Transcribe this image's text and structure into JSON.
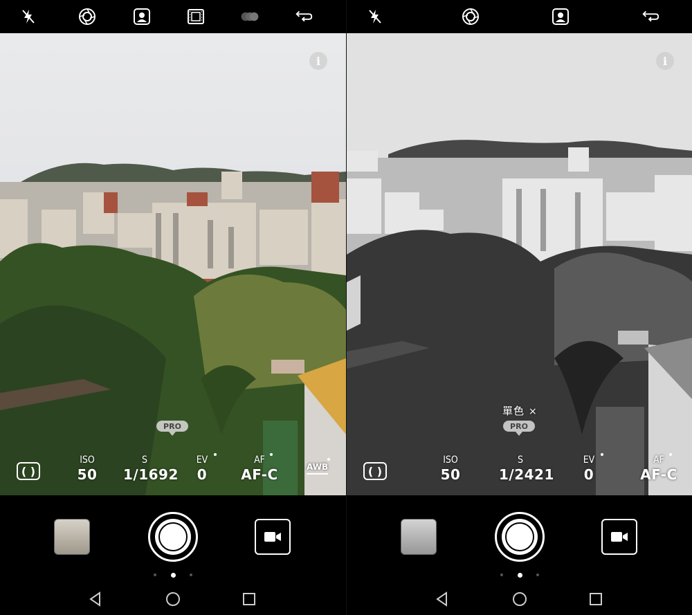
{
  "left": {
    "top_icons": [
      "flash-off-icon",
      "aperture-icon",
      "portrait-icon",
      "film-icon",
      "filter-circles-icon",
      "switch-camera-icon"
    ],
    "info_label": "i",
    "pro_badge": "PRO",
    "metering_label": "( )",
    "params": {
      "iso": {
        "label": "ISO",
        "value": "50"
      },
      "s": {
        "label": "S",
        "value": "1/1692"
      },
      "ev": {
        "label": "EV",
        "value": "0"
      },
      "af": {
        "label": "AF",
        "value": "AF-C"
      },
      "awb": {
        "label": "AWB"
      }
    },
    "pager": {
      "count": 3,
      "active": 1
    }
  },
  "right": {
    "top_icons": [
      "flash-off-icon",
      "aperture-icon",
      "portrait-icon",
      "switch-camera-icon"
    ],
    "info_label": "i",
    "filter_label": "單色",
    "filter_close": "×",
    "pro_badge": "PRO",
    "metering_label": "( )",
    "params": {
      "iso": {
        "label": "ISO",
        "value": "50"
      },
      "s": {
        "label": "S",
        "value": "1/2421"
      },
      "ev": {
        "label": "EV",
        "value": "0"
      },
      "af": {
        "label": "AF",
        "value": "AF-C"
      }
    },
    "pager": {
      "count": 3,
      "active": 1
    }
  },
  "nav_icons": [
    "back-icon",
    "home-icon",
    "recents-icon"
  ],
  "colors": {
    "bar": "#000000",
    "sky": "#e4e4e6",
    "foliage": "#4c6a2f",
    "accent_white": "#ffffff"
  }
}
